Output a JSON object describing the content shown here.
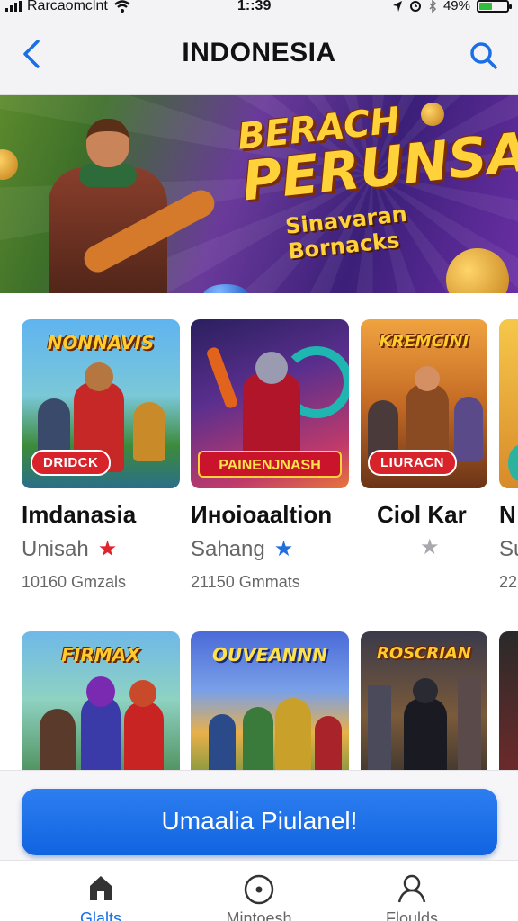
{
  "status_bar": {
    "carrier": "Rarcaomclnt",
    "time": "1::39",
    "battery": "49%",
    "battery_level": 0.45
  },
  "header": {
    "title": "INDONESIA",
    "back_icon": "chevron-left-icon",
    "search_icon": "search-icon"
  },
  "banner": {
    "headline_line1": "BERACH",
    "headline_line2": "PERUNSA!",
    "subtitle": "Sinavaran Bornacks"
  },
  "games_row1": [
    {
      "thumb_title": "NONNAVIS",
      "badge": "DRIDCK",
      "name": "Imdanasia",
      "subtitle": "Unisah",
      "star_color": "#e0242c",
      "count": "10160 Gmzals"
    },
    {
      "thumb_title": "",
      "badge": "PAINENJNASH",
      "name": "Инoioaaltion",
      "subtitle": "Sahang",
      "star_color": "#1f6fe0",
      "count": "21150 Gmmats"
    },
    {
      "thumb_title": "KREMCINI",
      "badge": "LIURACN",
      "name": "Ciol Kar",
      "subtitle": "",
      "star_color": "#a8a8ad",
      "count": ""
    },
    {
      "thumb_title": "",
      "badge": "",
      "name": "N",
      "subtitle": "Su",
      "star_color": "",
      "count": "22"
    }
  ],
  "games_row2": [
    {
      "thumb_title": "FIRMAX"
    },
    {
      "thumb_title": "OUVEANNN"
    },
    {
      "thumb_title": "ROSCRIAN"
    },
    {
      "thumb_title": ""
    }
  ],
  "cta": {
    "label": "Umaalia Piulanel!"
  },
  "tabs": [
    {
      "label": "Glalts",
      "icon": "home-icon",
      "active": true
    },
    {
      "label": "Mintoesh",
      "icon": "compass-icon",
      "active": false
    },
    {
      "label": "Floulds",
      "icon": "profile-icon",
      "active": false
    }
  ]
}
